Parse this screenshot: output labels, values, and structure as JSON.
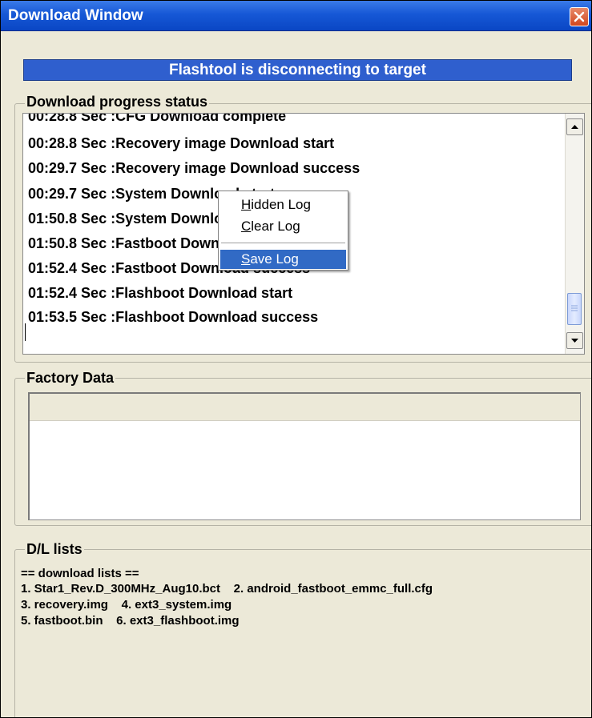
{
  "window": {
    "title": "Download Window",
    "close_icon": "close-icon"
  },
  "banner": {
    "text": "Flashtool is disconnecting to target",
    "color": "#2f5fce"
  },
  "progress": {
    "group_label": "Download progress status",
    "log_lines": [
      "00:28.8 Sec :CFG Download complete",
      "00:28.8 Sec :Recovery image Download start",
      "00:29.7 Sec :Recovery image Download success",
      "00:29.7 Sec :System Download start",
      "01:50.8 Sec :System Download success",
      "01:50.8 Sec :Fastboot Download start",
      "01:52.4 Sec :Fastboot Download success",
      "01:52.4 Sec :Flashboot Download start",
      "01:53.5 Sec :Flashboot Download success"
    ]
  },
  "context_menu": {
    "items": [
      {
        "label": "Hidden Log",
        "mnemonic": "H"
      },
      {
        "label": "Clear Log",
        "mnemonic": "C"
      },
      {
        "label": "Save Log",
        "mnemonic": "S",
        "highlighted": true
      }
    ],
    "highlight_color": "#316ac5"
  },
  "factory": {
    "group_label": "Factory Data"
  },
  "dl_lists": {
    "group_label": "D/L lists",
    "lines": [
      "== download lists ==",
      "1. Star1_Rev.D_300MHz_Aug10.bct    2. android_fastboot_emmc_full.cfg",
      "3. recovery.img    4. ext3_system.img",
      "5. fastboot.bin    6. ext3_flashboot.img"
    ]
  }
}
